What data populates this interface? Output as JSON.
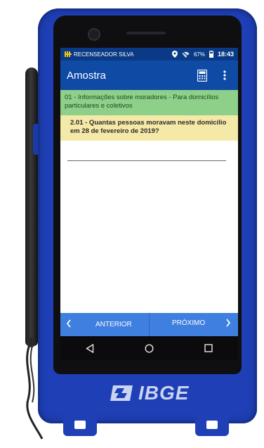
{
  "status_bar": {
    "app_label": "RECENSEADOR SILVA",
    "battery_percent": "67%",
    "time": "18:43"
  },
  "toolbar": {
    "title": "Amostra"
  },
  "section": {
    "text": "01 - Informações sobre moradores - Para domicílios particulares e coletivos"
  },
  "question": {
    "text": "2.01 - Quantas pessoas moravam neste domicílio em 28 de fevereiro de 2019?"
  },
  "answer": {
    "value": ""
  },
  "navigation": {
    "prev_label": "ANTERIOR",
    "next_label": "PRÓXIMO"
  },
  "device": {
    "brand": "IBGE"
  },
  "colors": {
    "device_blue": "#1e3fb5",
    "status_bar": "#0a3a86",
    "toolbar": "#0f4aa5",
    "section_green": "#8ed08a",
    "question_yellow": "#f5e9a8",
    "nav_blue": "#3e7fe0"
  },
  "icons": {
    "status": [
      "location-icon",
      "wifi-off-icon",
      "battery-icon"
    ],
    "toolbar": [
      "calculator-icon",
      "more-vert-icon"
    ],
    "system_nav": [
      "back-icon",
      "home-icon",
      "recents-icon"
    ]
  }
}
